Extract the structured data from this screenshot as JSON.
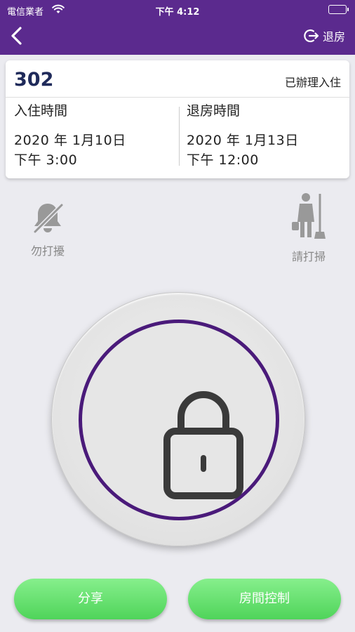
{
  "status_bar": {
    "carrier": "電信業者",
    "time": "下午 4:12"
  },
  "header": {
    "back_icon": "chevron-left-icon",
    "checkout_icon": "logout-icon",
    "checkout_label": "退房"
  },
  "booking": {
    "room_number": "302",
    "status": "已辦理入住",
    "checkin": {
      "label": "入住時間",
      "date": "2020 年 1月10日",
      "time": "下午 3:00"
    },
    "checkout": {
      "label": "退房時間",
      "date": "2020 年 1月13日",
      "time": "下午 12:00"
    }
  },
  "actions": {
    "do_not_disturb": {
      "label": "勿打擾",
      "icon": "bell-slash-icon"
    },
    "cleaning": {
      "label": "請打掃",
      "icon": "housekeeper-icon"
    }
  },
  "lock": {
    "icon": "padlock-icon",
    "ring_color": "#4a1a7a"
  },
  "buttons": {
    "share_label": "分享",
    "room_control_label": "房間控制"
  },
  "colors": {
    "header_bg": "#5b2a8e",
    "button_green": "#4fd45a",
    "page_bg": "#ebebf0"
  }
}
